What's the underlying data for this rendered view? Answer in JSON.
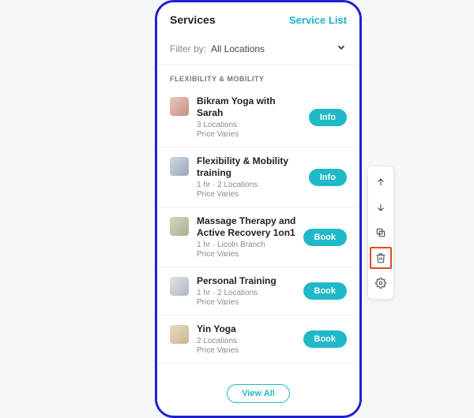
{
  "header": {
    "title": "Services",
    "link": "Service List"
  },
  "filter": {
    "label": "Filter by:",
    "value": "All Locations"
  },
  "section": {
    "title": "FLEXIBILITY & MOBILITY"
  },
  "items": [
    {
      "title": "Bikram Yoga with Sarah",
      "meta": "3 Locations",
      "price": "Price Varies",
      "cta": "Info"
    },
    {
      "title": "Flexibility & Mobility training",
      "meta": "1 hr · 2 Locations",
      "price": "Price Varies",
      "cta": "Info"
    },
    {
      "title": "Massage Therapy and Active Recovery 1on1",
      "meta": "1 hr · Licoln Branch",
      "price": "Price Varies",
      "cta": "Book"
    },
    {
      "title": "Personal Training",
      "meta": "1 hr · 2 Locations",
      "price": "Price Varies",
      "cta": "Book"
    },
    {
      "title": "Yin Yoga",
      "meta": "2 Locations",
      "price": "Price Varies",
      "cta": "Book"
    }
  ],
  "footer": {
    "view_all": "View All"
  },
  "toolbar": {
    "selected": "delete"
  },
  "colors": {
    "accent": "#1fb9c8",
    "frame": "#2020d0",
    "highlight": "#e24a1f"
  }
}
